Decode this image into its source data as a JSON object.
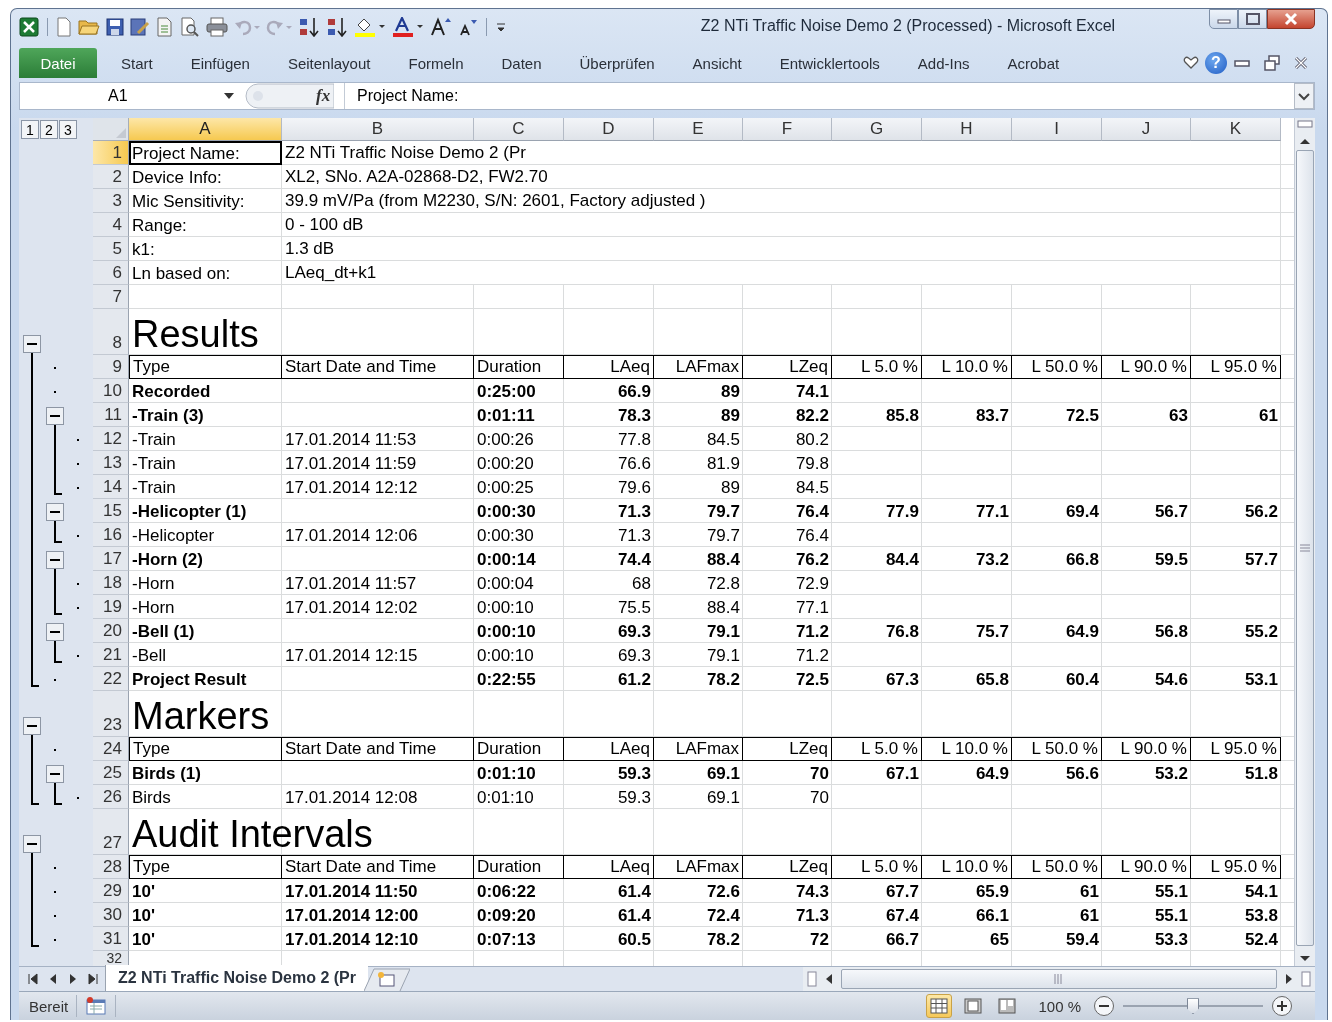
{
  "window": {
    "title": "Z2 NTi Traffic Noise Demo 2 (Processed)  -  Microsoft Excel"
  },
  "ribbon_tabs": [
    {
      "label": "Datei",
      "kind": "file",
      "selected": false
    },
    {
      "label": "Start",
      "kind": "tab",
      "selected": false
    },
    {
      "label": "Einfügen",
      "kind": "tab",
      "selected": false
    },
    {
      "label": "Seitenlayout",
      "kind": "tab",
      "selected": false
    },
    {
      "label": "Formeln",
      "kind": "tab",
      "selected": false
    },
    {
      "label": "Daten",
      "kind": "tab",
      "selected": false
    },
    {
      "label": "Überprüfen",
      "kind": "tab",
      "selected": false
    },
    {
      "label": "Ansicht",
      "kind": "tab",
      "selected": false
    },
    {
      "label": "Entwicklertools",
      "kind": "tab",
      "selected": false
    },
    {
      "label": "Add-Ins",
      "kind": "tab",
      "selected": false
    },
    {
      "label": "Acrobat",
      "kind": "tab",
      "selected": false
    }
  ],
  "help_button": "?",
  "formula_bar": {
    "name_box": "A1",
    "function_label": "fx",
    "formula": "Project Name:"
  },
  "outline_levels": [
    "1",
    "2",
    "3"
  ],
  "columns": [
    {
      "label": "A",
      "selected": true
    },
    {
      "label": "B",
      "selected": false
    },
    {
      "label": "C",
      "selected": false
    },
    {
      "label": "D",
      "selected": false
    },
    {
      "label": "E",
      "selected": false
    },
    {
      "label": "F",
      "selected": false
    },
    {
      "label": "G",
      "selected": false
    },
    {
      "label": "H",
      "selected": false
    },
    {
      "label": "I",
      "selected": false
    },
    {
      "label": "J",
      "selected": false
    },
    {
      "label": "K",
      "selected": false
    }
  ],
  "rows": [
    {
      "number": "1",
      "selected": true,
      "kind": "info",
      "cells": {
        "a": "Project Name:",
        "b": "Z2 NTi Traffic Noise Demo 2 (Pr"
      }
    },
    {
      "number": "2",
      "selected": false,
      "kind": "info",
      "cells": {
        "a": "Device Info:",
        "b": "XL2, SNo. A2A-02868-D2, FW2.70"
      }
    },
    {
      "number": "3",
      "selected": false,
      "kind": "info",
      "cells": {
        "a": "Mic Sensitivity:",
        "b": "39.9 mV/Pa (from M2230, S/N: 2601, Factory adjusted )"
      }
    },
    {
      "number": "4",
      "selected": false,
      "kind": "info",
      "cells": {
        "a": "Range:",
        "b": "0 - 100 dB"
      }
    },
    {
      "number": "5",
      "selected": false,
      "kind": "info",
      "cells": {
        "a": "k1:",
        "b": "1.3 dB"
      }
    },
    {
      "number": "6",
      "selected": false,
      "kind": "info",
      "cells": {
        "a": "Ln based on:",
        "b": "LAeq_dt+k1"
      }
    },
    {
      "number": "7",
      "selected": false,
      "kind": "info",
      "cells": {}
    },
    {
      "number": "8",
      "selected": false,
      "kind": "section",
      "outline": [
        {
          "kind": "collapse"
        },
        {
          "kind": "blank"
        },
        {
          "kind": "blank"
        }
      ],
      "cells": {
        "a": "Results"
      }
    },
    {
      "number": "9",
      "selected": false,
      "kind": "header",
      "outline": [
        {
          "kind": "line"
        },
        {
          "kind": "dot"
        },
        {
          "kind": "blank"
        }
      ],
      "cells": {
        "a": "Type",
        "b": "Start Date and Time",
        "c": "Duration",
        "d": "LAeq",
        "e": "LAFmax",
        "f": "LZeq",
        "g": "L 5.0 %",
        "h": "L 10.0 %",
        "i": "L 50.0 %",
        "j": "L 90.0 %",
        "k": "L 95.0 %"
      }
    },
    {
      "number": "10",
      "selected": false,
      "kind": "group",
      "outline": [
        {
          "kind": "line"
        },
        {
          "kind": "dot"
        },
        {
          "kind": "blank"
        }
      ],
      "cells": {
        "a": "Recorded",
        "c": "0:25:00",
        "d": "66.9",
        "e": "89",
        "f": "74.1"
      }
    },
    {
      "number": "11",
      "selected": false,
      "kind": "group",
      "outline": [
        {
          "kind": "line"
        },
        {
          "kind": "collapse"
        },
        {
          "kind": "blank"
        }
      ],
      "cells": {
        "a": "-Train (3)",
        "c": "0:01:11",
        "d": "78.3",
        "e": "89",
        "f": "82.2",
        "g": "85.8",
        "h": "83.7",
        "i": "72.5",
        "j": "63",
        "k": "61"
      }
    },
    {
      "number": "12",
      "selected": false,
      "kind": "item",
      "outline": [
        {
          "kind": "line"
        },
        {
          "kind": "line"
        },
        {
          "kind": "dot"
        }
      ],
      "cells": {
        "a": "-Train",
        "b": "17.01.2014 11:53",
        "c": "0:00:26",
        "d": "77.8",
        "e": "84.5",
        "f": "80.2"
      }
    },
    {
      "number": "13",
      "selected": false,
      "kind": "item",
      "outline": [
        {
          "kind": "line"
        },
        {
          "kind": "line"
        },
        {
          "kind": "dot"
        }
      ],
      "cells": {
        "a": "-Train",
        "b": "17.01.2014 11:59",
        "c": "0:00:20",
        "d": "76.6",
        "e": "81.9",
        "f": "79.8"
      }
    },
    {
      "number": "14",
      "selected": false,
      "kind": "item",
      "outline": [
        {
          "kind": "line"
        },
        {
          "kind": "end"
        },
        {
          "kind": "dot"
        }
      ],
      "cells": {
        "a": "-Train",
        "b": "17.01.2014 12:12",
        "c": "0:00:25",
        "d": "79.6",
        "e": "89",
        "f": "84.5"
      }
    },
    {
      "number": "15",
      "selected": false,
      "kind": "group",
      "outline": [
        {
          "kind": "line"
        },
        {
          "kind": "collapse"
        },
        {
          "kind": "blank"
        }
      ],
      "cells": {
        "a": "-Helicopter (1)",
        "c": "0:00:30",
        "d": "71.3",
        "e": "79.7",
        "f": "76.4",
        "g": "77.9",
        "h": "77.1",
        "i": "69.4",
        "j": "56.7",
        "k": "56.2"
      }
    },
    {
      "number": "16",
      "selected": false,
      "kind": "item",
      "outline": [
        {
          "kind": "line"
        },
        {
          "kind": "end"
        },
        {
          "kind": "dot"
        }
      ],
      "cells": {
        "a": "-Helicopter",
        "b": "17.01.2014 12:06",
        "c": "0:00:30",
        "d": "71.3",
        "e": "79.7",
        "f": "76.4"
      }
    },
    {
      "number": "17",
      "selected": false,
      "kind": "group",
      "outline": [
        {
          "kind": "line"
        },
        {
          "kind": "collapse"
        },
        {
          "kind": "blank"
        }
      ],
      "cells": {
        "a": "-Horn (2)",
        "c": "0:00:14",
        "d": "74.4",
        "e": "88.4",
        "f": "76.2",
        "g": "84.4",
        "h": "73.2",
        "i": "66.8",
        "j": "59.5",
        "k": "57.7"
      }
    },
    {
      "number": "18",
      "selected": false,
      "kind": "item",
      "outline": [
        {
          "kind": "line"
        },
        {
          "kind": "line"
        },
        {
          "kind": "dot"
        }
      ],
      "cells": {
        "a": "-Horn",
        "b": "17.01.2014 11:57",
        "c": "0:00:04",
        "d": "68",
        "e": "72.8",
        "f": "72.9"
      }
    },
    {
      "number": "19",
      "selected": false,
      "kind": "item",
      "outline": [
        {
          "kind": "line"
        },
        {
          "kind": "end"
        },
        {
          "kind": "dot"
        }
      ],
      "cells": {
        "a": "-Horn",
        "b": "17.01.2014 12:02",
        "c": "0:00:10",
        "d": "75.5",
        "e": "88.4",
        "f": "77.1"
      }
    },
    {
      "number": "20",
      "selected": false,
      "kind": "group",
      "outline": [
        {
          "kind": "line"
        },
        {
          "kind": "collapse"
        },
        {
          "kind": "blank"
        }
      ],
      "cells": {
        "a": "-Bell (1)",
        "c": "0:00:10",
        "d": "69.3",
        "e": "79.1",
        "f": "71.2",
        "g": "76.8",
        "h": "75.7",
        "i": "64.9",
        "j": "56.8",
        "k": "55.2"
      }
    },
    {
      "number": "21",
      "selected": false,
      "kind": "item",
      "outline": [
        {
          "kind": "line"
        },
        {
          "kind": "end"
        },
        {
          "kind": "dot"
        }
      ],
      "cells": {
        "a": "-Bell",
        "b": "17.01.2014 12:15",
        "c": "0:00:10",
        "d": "69.3",
        "e": "79.1",
        "f": "71.2"
      }
    },
    {
      "number": "22",
      "selected": false,
      "kind": "group",
      "outline": [
        {
          "kind": "end"
        },
        {
          "kind": "dot"
        },
        {
          "kind": "blank"
        }
      ],
      "cells": {
        "a": "Project Result",
        "c": "0:22:55",
        "d": "61.2",
        "e": "78.2",
        "f": "72.5",
        "g": "67.3",
        "h": "65.8",
        "i": "60.4",
        "j": "54.6",
        "k": "53.1"
      }
    },
    {
      "number": "23",
      "selected": false,
      "kind": "section",
      "outline": [
        {
          "kind": "collapse"
        },
        {
          "kind": "blank"
        },
        {
          "kind": "blank"
        }
      ],
      "cells": {
        "a": "Markers"
      }
    },
    {
      "number": "24",
      "selected": false,
      "kind": "header",
      "outline": [
        {
          "kind": "line"
        },
        {
          "kind": "dot"
        },
        {
          "kind": "blank"
        }
      ],
      "cells": {
        "a": "Type",
        "b": "Start Date and Time",
        "c": "Duration",
        "d": "LAeq",
        "e": "LAFmax",
        "f": "LZeq",
        "g": "L 5.0 %",
        "h": "L 10.0 %",
        "i": "L 50.0 %",
        "j": "L 90.0 %",
        "k": "L 95.0 %"
      }
    },
    {
      "number": "25",
      "selected": false,
      "kind": "group",
      "outline": [
        {
          "kind": "line"
        },
        {
          "kind": "collapse"
        },
        {
          "kind": "blank"
        }
      ],
      "cells": {
        "a": "Birds (1)",
        "c": "0:01:10",
        "d": "59.3",
        "e": "69.1",
        "f": "70",
        "g": "67.1",
        "h": "64.9",
        "i": "56.6",
        "j": "53.2",
        "k": "51.8"
      }
    },
    {
      "number": "26",
      "selected": false,
      "kind": "item",
      "outline": [
        {
          "kind": "end"
        },
        {
          "kind": "end"
        },
        {
          "kind": "dot"
        }
      ],
      "cells": {
        "a": "Birds",
        "b": "17.01.2014 12:08",
        "c": "0:01:10",
        "d": "59.3",
        "e": "69.1",
        "f": "70"
      }
    },
    {
      "number": "27",
      "selected": false,
      "kind": "section",
      "outline": [
        {
          "kind": "collapse"
        },
        {
          "kind": "blank"
        },
        {
          "kind": "blank"
        }
      ],
      "cells": {
        "a": "Audit Intervals"
      }
    },
    {
      "number": "28",
      "selected": false,
      "kind": "header",
      "outline": [
        {
          "kind": "line"
        },
        {
          "kind": "dot"
        },
        {
          "kind": "blank"
        }
      ],
      "cells": {
        "a": "Type",
        "b": "Start Date and Time",
        "c": "Duration",
        "d": "LAeq",
        "e": "LAFmax",
        "f": "LZeq",
        "g": "L 5.0 %",
        "h": "L 10.0 %",
        "i": "L 50.0 %",
        "j": "L 90.0 %",
        "k": "L 95.0 %"
      }
    },
    {
      "number": "29",
      "selected": false,
      "kind": "group",
      "outline": [
        {
          "kind": "line"
        },
        {
          "kind": "dot"
        },
        {
          "kind": "blank"
        }
      ],
      "cells": {
        "a": "10'",
        "b": "17.01.2014 11:50",
        "c": "0:06:22",
        "d": "61.4",
        "e": "72.6",
        "f": "74.3",
        "g": "67.7",
        "h": "65.9",
        "i": "61",
        "j": "55.1",
        "k": "54.1"
      }
    },
    {
      "number": "30",
      "selected": false,
      "kind": "group",
      "outline": [
        {
          "kind": "line"
        },
        {
          "kind": "dot"
        },
        {
          "kind": "blank"
        }
      ],
      "cells": {
        "a": "10'",
        "b": "17.01.2014 12:00",
        "c": "0:09:20",
        "d": "61.4",
        "e": "72.4",
        "f": "71.3",
        "g": "67.4",
        "h": "66.1",
        "i": "61",
        "j": "55.1",
        "k": "53.8"
      }
    },
    {
      "number": "31",
      "selected": false,
      "kind": "group",
      "outline": [
        {
          "kind": "end"
        },
        {
          "kind": "dot"
        },
        {
          "kind": "blank"
        }
      ],
      "cells": {
        "a": "10'",
        "b": "17.01.2014 12:10",
        "c": "0:07:13",
        "d": "60.5",
        "e": "78.2",
        "f": "72",
        "g": "66.7",
        "h": "65",
        "i": "59.4",
        "j": "53.3",
        "k": "52.4"
      }
    },
    {
      "number": "32",
      "selected": false,
      "kind": "partial",
      "cells": {}
    }
  ],
  "sheet_tabs": [
    {
      "label": "Z2 NTi Traffic Noise Demo 2 (Pr",
      "selected": true
    }
  ],
  "status_bar": {
    "text": "Bereit",
    "views": [
      {
        "kind": "normal",
        "selected": true
      },
      {
        "kind": "layout",
        "selected": false
      },
      {
        "kind": "pagebreak",
        "selected": false
      }
    ],
    "zoom": "100 %",
    "zoom_slider": {
      "level": 0.5
    }
  }
}
